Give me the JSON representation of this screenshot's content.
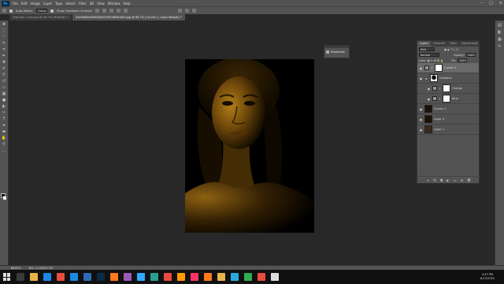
{
  "app": {
    "logo": "Ps"
  },
  "menubar": {
    "items": [
      "File",
      "Edit",
      "Image",
      "Layer",
      "Type",
      "Select",
      "Filter",
      "3D",
      "View",
      "Window",
      "Help"
    ],
    "window_controls": [
      "minimize-icon",
      "maximize-icon",
      "close-icon"
    ]
  },
  "options": {
    "auto_select_label": "Auto-Select:",
    "auto_select_value": "Group",
    "transform_label": "Show Transform Controls"
  },
  "tabs": [
    {
      "label": "Dramatic Color.psd @ 66.7% (RGB/8#) *",
      "active": false
    },
    {
      "label": "43e90fb6a3fb5f2b4f7c0f54f69440fd.jpg @ 66.7% (Curves 2, Layer Mask/8) *",
      "active": true
    }
  ],
  "tools": [
    "move-icon",
    "marquee-icon",
    "lasso-icon",
    "quick-select-icon",
    "crop-icon",
    "eyedropper-icon",
    "healing-icon",
    "brush-icon",
    "stamp-icon",
    "history-brush-icon",
    "eraser-icon",
    "gradient-icon",
    "blur-icon",
    "dodge-icon",
    "pen-icon",
    "type-icon",
    "path-select-icon",
    "shape-icon",
    "hand-icon",
    "zoom-icon",
    "more-icon"
  ],
  "properties_panel": {
    "label": "Properties"
  },
  "layers_panel": {
    "tabs": [
      {
        "label": "Layers",
        "active": true
      },
      {
        "label": "Channels",
        "active": false
      },
      {
        "label": "Paths",
        "active": false
      },
      {
        "label": "Adjustments",
        "active": false
      }
    ],
    "filter_value": "Kind",
    "blend_mode": "Normal",
    "opacity_label": "Opacity:",
    "opacity_value": "100%",
    "lock_label": "Lock:",
    "fill_label": "Fill:",
    "fill_value": "100%",
    "layers": [
      {
        "name": "Curves 2",
        "kind": "adjustment",
        "mask": "white",
        "selected": true,
        "indent": false
      },
      {
        "name": "Gradient",
        "kind": "adjustment",
        "mask": "white",
        "selected": false,
        "indent": false
      },
      {
        "name": "Orange",
        "kind": "adjustment",
        "mask": "white",
        "selected": false,
        "indent": true
      },
      {
        "name": "Blue",
        "kind": "adjustment",
        "mask": "white",
        "selected": false,
        "indent": true
      },
      {
        "name": "Curves 1",
        "kind": "image",
        "mask": "",
        "selected": false,
        "indent": false
      },
      {
        "name": "Layer 4",
        "kind": "image",
        "mask": "",
        "selected": false,
        "indent": false
      },
      {
        "name": "Layer 1",
        "kind": "image",
        "mask": "",
        "selected": false,
        "indent": false
      }
    ],
    "footer_icons": [
      "link-icon",
      "fx-icon",
      "mask-icon",
      "adjustment-icon",
      "folder-icon",
      "new-layer-icon",
      "trash-icon"
    ]
  },
  "status": {
    "zoom": "66.67%",
    "doc": "Doc: 2.47M/15.7M"
  },
  "taskbar": {
    "clock_time": "4:47 PM",
    "clock_date": "8/13/2020",
    "icon_colors": [
      "#3b3b3b",
      "#e8b44a",
      "#1e88e5",
      "#e84c3d",
      "#1e88e5",
      "#2d6ab7",
      "#0a2a45",
      "#ff7b1c",
      "#9b59b6",
      "#31a8ff",
      "#2a9d8f",
      "#e84c3d",
      "#ff9a00",
      "#ff3366",
      "#ff7b1c",
      "#e8b44a",
      "#29a8e0",
      "#33aa55",
      "#e84c3d",
      "#ddd"
    ]
  }
}
